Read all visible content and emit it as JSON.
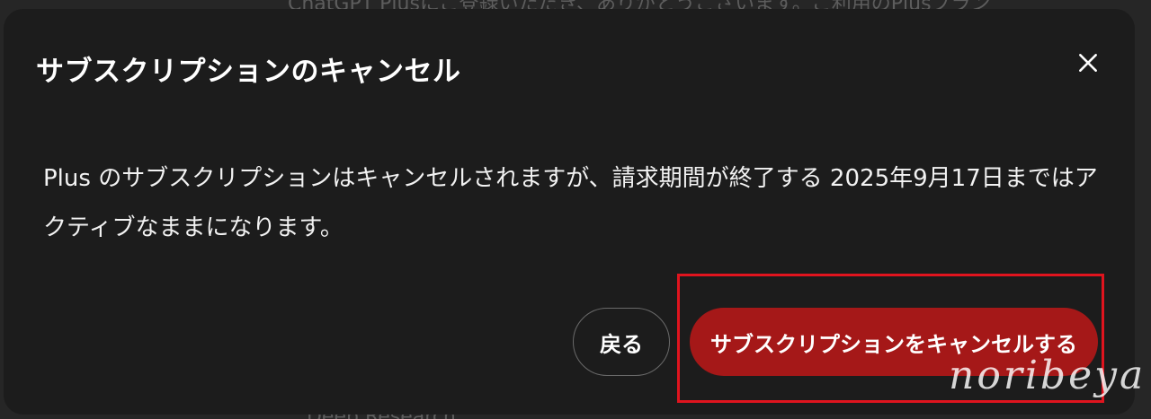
{
  "backdrop": {
    "top_text": "ChatGPT Plusにご登録いただき、ありがとうございます。ご利用のPlusプラン",
    "bottom_text": "...Deep Research..."
  },
  "modal": {
    "title": "サブスクリプションのキャンセル",
    "body": "Plus のサブスクリプションはキャンセルされますが、請求期間が終了する 2025年9月17日まではアクティブなままになります。",
    "back_button": "戻る",
    "cancel_button": "サブスクリプションをキャンセルする"
  },
  "watermark": "noribeya",
  "colors": {
    "modal_bg": "#1c1c1c",
    "danger": "#a51818",
    "highlight": "#e0141e"
  },
  "icons": {
    "close": "close-icon"
  }
}
